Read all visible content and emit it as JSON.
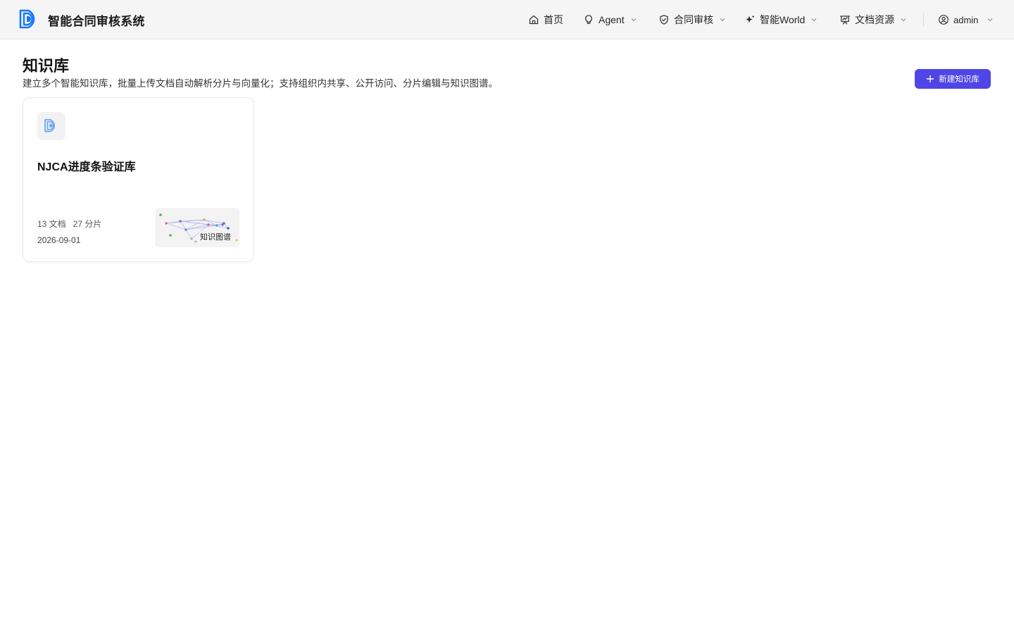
{
  "header": {
    "app_title": "智能合同审核系统",
    "nav": [
      {
        "label": "首页",
        "icon": "home-icon",
        "has_dropdown": false
      },
      {
        "label": "Agent",
        "icon": "lightbulb-icon",
        "has_dropdown": true
      },
      {
        "label": "合同审核",
        "icon": "shield-check-icon",
        "has_dropdown": true
      },
      {
        "label": "智能World",
        "icon": "sparkle-icon",
        "has_dropdown": true
      },
      {
        "label": "文档资源",
        "icon": "presentation-icon",
        "has_dropdown": true
      }
    ],
    "user": {
      "name": "admin",
      "icon": "user-circle-icon"
    }
  },
  "page": {
    "title": "知识库",
    "description": "建立多个智能知识库，批量上传文档自动解析分片与向量化；支持组织内共享、公开访问、分片编辑与知识图谱。",
    "new_button_label": "新建知识库"
  },
  "knowledge_bases": [
    {
      "name": "NJCA进度条验证库",
      "docs": "13 文档",
      "chunks": "27 分片",
      "date": "2026-09-01",
      "graph_label": "知识图谱"
    }
  ],
  "colors": {
    "primary": "#4f46e5",
    "logo_blue": "#1677ff",
    "header_bg": "#f5f5f5"
  }
}
